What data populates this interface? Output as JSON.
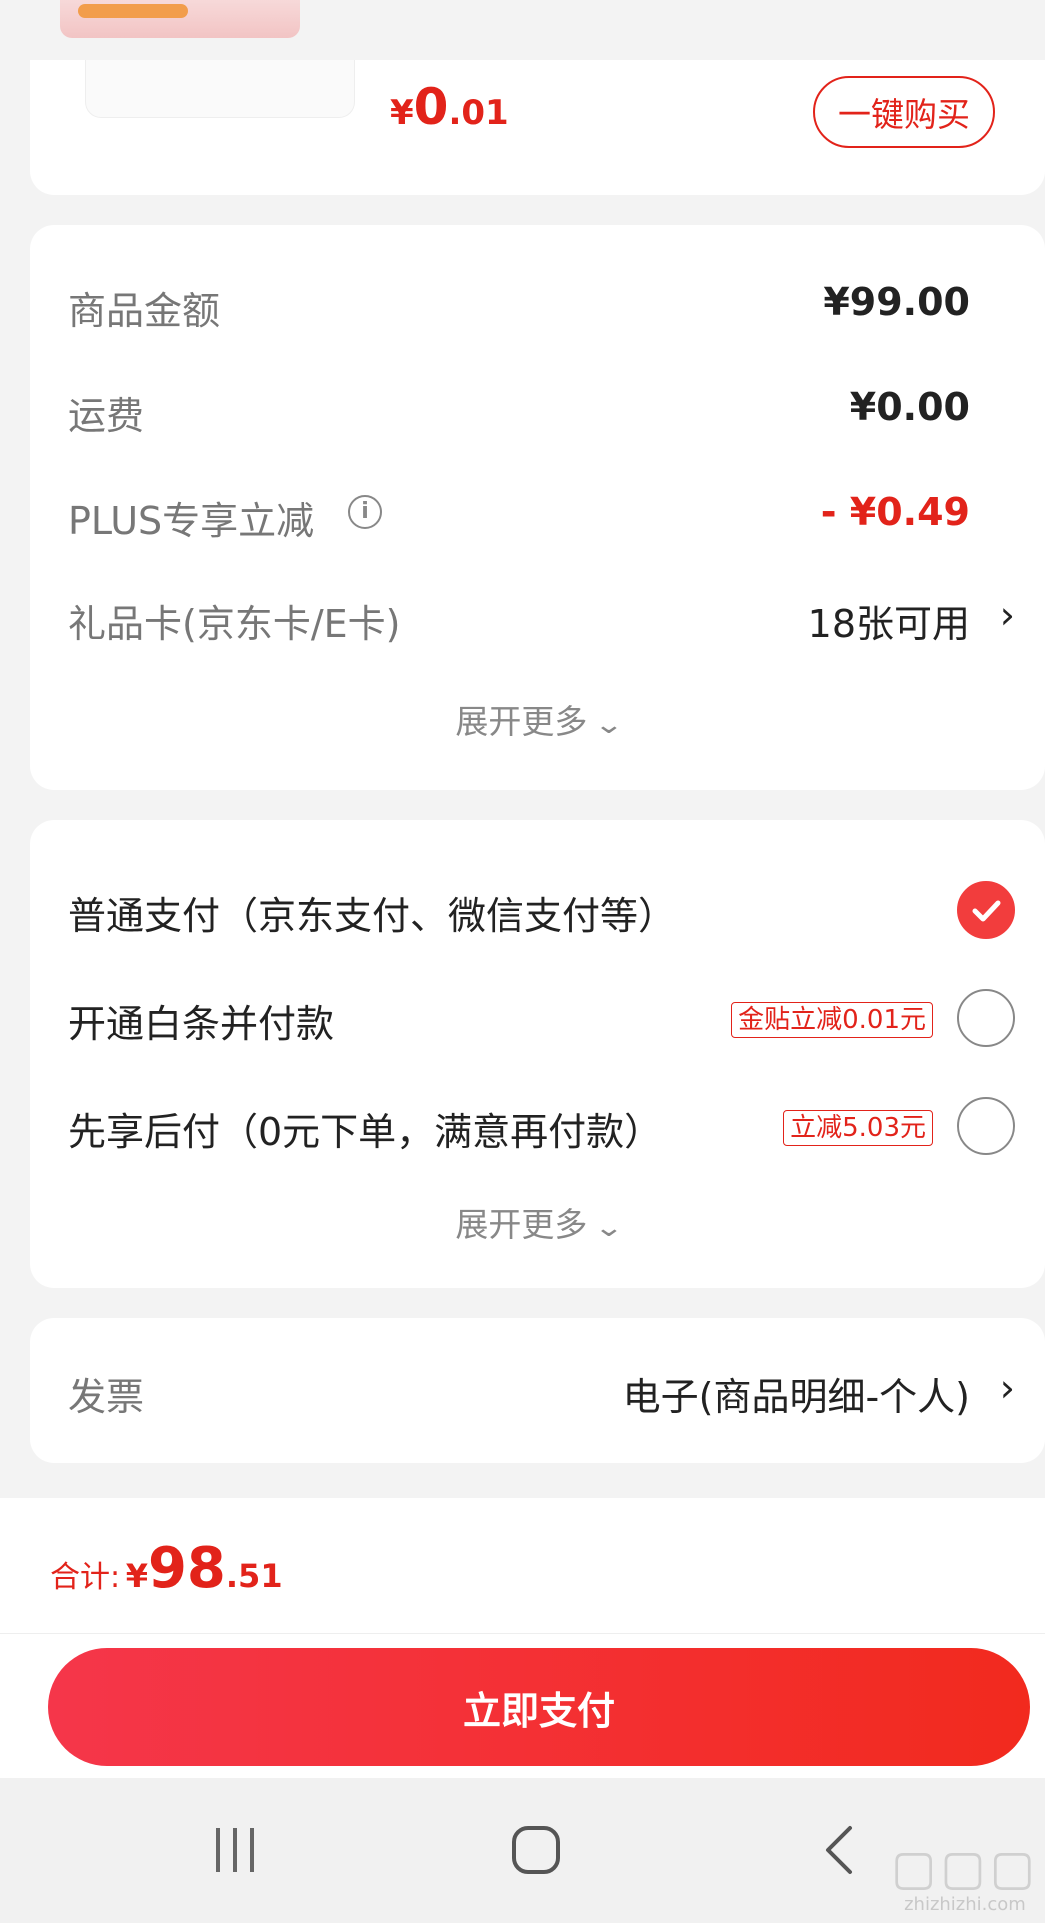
{
  "top_product": {
    "price_symbol": "¥",
    "price_int": "0",
    "price_dec": ".01",
    "buy_button": "一键购买"
  },
  "summary": {
    "goods_label": "商品金额",
    "goods_value": "¥99.00",
    "shipping_label": "运费",
    "shipping_value": "¥0.00",
    "plus_label": "PLUS专享立减",
    "plus_value": "- ¥0.49",
    "giftcard_label": "礼品卡(京东卡/E卡)",
    "giftcard_value": "18张可用",
    "expand": "展开更多"
  },
  "payment": {
    "options": [
      {
        "label": "普通支付（京东支付、微信支付等）",
        "tag": "",
        "checked": true
      },
      {
        "label": "开通白条并付款",
        "tag": "金贴立减0.01元",
        "checked": false
      },
      {
        "label": "先享后付（0元下单，满意再付款）",
        "tag": "立减5.03元",
        "checked": false
      }
    ],
    "expand": "展开更多"
  },
  "invoice": {
    "label": "发票",
    "value": "电子(商品明细-个人)"
  },
  "total": {
    "label": "合计:",
    "symbol": "¥",
    "int": "98",
    "dec": ".51"
  },
  "pay_button": "立即支付",
  "watermark": "zhizhizhi.com",
  "colors": {
    "accent": "#e2231a",
    "button_start": "#f5364a",
    "button_end": "#f22a1e",
    "background": "#f3f3f3"
  },
  "icons": [
    "info-icon",
    "chevron-right-icon",
    "chevron-down-icon",
    "check-icon",
    "nav-recents-icon",
    "nav-home-icon",
    "nav-back-icon"
  ]
}
